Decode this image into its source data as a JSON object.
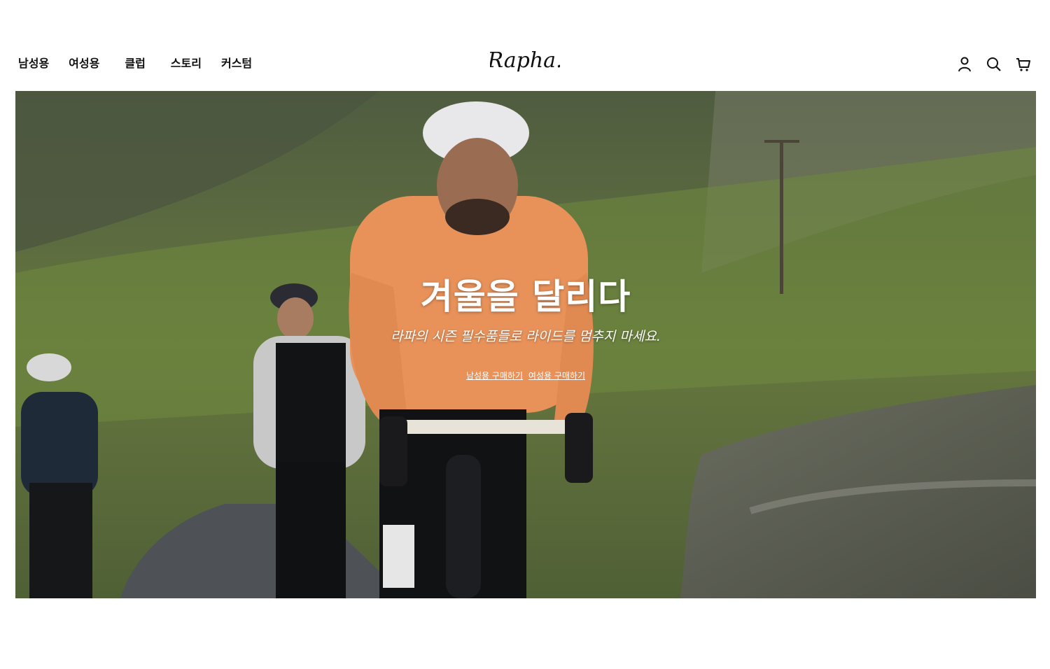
{
  "header": {
    "nav": [
      "남성용",
      "여성용",
      "클럽",
      "스토리",
      "커스텀"
    ],
    "logo_text": "Rapha.",
    "icons": [
      "account-icon",
      "search-icon",
      "cart-icon"
    ]
  },
  "hero": {
    "title": "겨울을 달리다",
    "subtitle": "라파의 시즌 필수품들로 라이드를 멈추지 마세요.",
    "links": [
      "남성용 구매하기",
      "여성용 구매하기"
    ]
  },
  "colors": {
    "text": "#111111",
    "background": "#ffffff",
    "hero_text": "#ffffff"
  }
}
